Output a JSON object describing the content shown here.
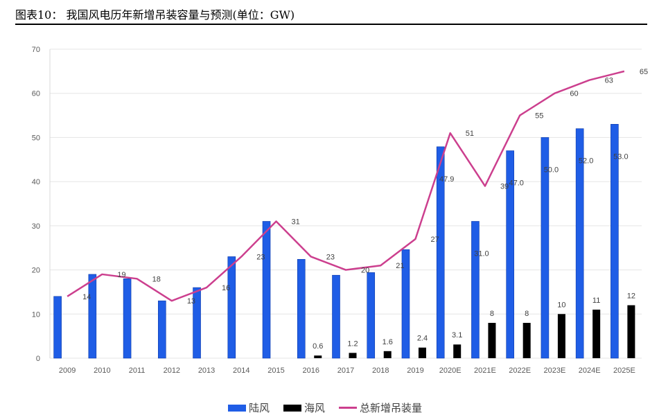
{
  "header": {
    "title": "图表10：  我国风电历年新增吊装容量与预测(单位：GW)"
  },
  "colors": {
    "onshore": "#1f5de6",
    "offshore": "#000000",
    "total": "#cc3f8e",
    "grid": "#e5e5e5"
  },
  "chart_data": {
    "type": "bar",
    "categories": [
      "2009",
      "2010",
      "2011",
      "2012",
      "2013",
      "2014",
      "2015",
      "2016",
      "2017",
      "2018",
      "2019",
      "2020E",
      "2021E",
      "2022E",
      "2023E",
      "2024E",
      "2025E"
    ],
    "ylim": [
      0,
      70
    ],
    "yticks": [
      0,
      10,
      20,
      30,
      40,
      50,
      60,
      70
    ],
    "grid": true,
    "legend_position": "bottom",
    "series": [
      {
        "name": "陆风",
        "kind": "bar",
        "values": [
          14,
          19,
          18,
          13,
          16,
          23,
          31,
          22.4,
          18.8,
          19.4,
          24.6,
          47.9,
          31.0,
          47.0,
          50.0,
          52.0,
          53.0
        ],
        "labels": [
          "",
          "",
          "",
          "",
          "",
          "",
          "",
          "",
          "",
          "",
          "",
          "47.9",
          "31.0",
          "47.0",
          "50.0",
          "52.0",
          "53.0"
        ]
      },
      {
        "name": "海风",
        "kind": "bar",
        "values": [
          0,
          0,
          0,
          0,
          0,
          0,
          0,
          0.6,
          1.2,
          1.6,
          2.4,
          3.1,
          8,
          8,
          10,
          11,
          12
        ],
        "labels": [
          "",
          "",
          "",
          "",
          "",
          "",
          "",
          "0.6",
          "1.2",
          "1.6",
          "2.4",
          "3.1",
          "8",
          "8",
          "10",
          "11",
          "12"
        ]
      },
      {
        "name": "总新增吊装量",
        "kind": "line",
        "values": [
          14,
          19,
          18,
          13,
          16,
          23,
          31,
          23,
          20,
          21,
          27,
          51,
          39,
          55,
          60,
          63,
          65
        ],
        "labels": [
          "14",
          "19",
          "18",
          "13",
          "16",
          "23",
          "31",
          "23",
          "20",
          "21",
          "27",
          "51",
          "39",
          "55",
          "60",
          "63",
          "65"
        ]
      }
    ]
  }
}
